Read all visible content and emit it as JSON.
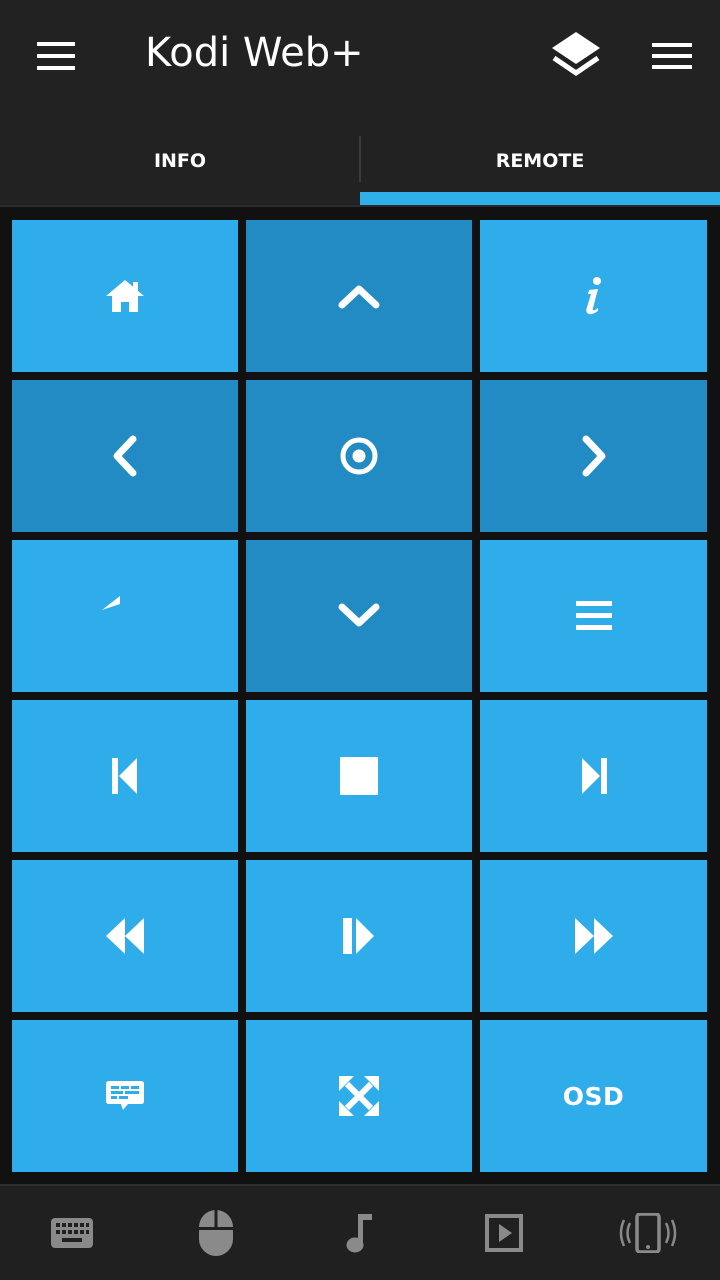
{
  "app": {
    "title": "Kodi Web+"
  },
  "tabs": [
    {
      "label": "INFO"
    },
    {
      "label": "REMOTE"
    }
  ],
  "active_tab": "REMOTE",
  "colors": {
    "appbar": "#222222",
    "accent": "#2fb0e8",
    "tile": "#2fadea",
    "tile_dark": "#228bc3",
    "background": "#111111",
    "bottom_icons": "#8a8a8a"
  },
  "remote": {
    "buttons": [
      {
        "icon": "home-icon"
      },
      {
        "icon": "chevron-up-icon"
      },
      {
        "icon": "info-icon"
      },
      {
        "icon": "chevron-left-icon"
      },
      {
        "icon": "select-circle-icon"
      },
      {
        "icon": "chevron-right-icon"
      },
      {
        "icon": "back-arrow-icon"
      },
      {
        "icon": "chevron-down-icon"
      },
      {
        "icon": "context-menu-icon"
      },
      {
        "icon": "skip-previous-icon"
      },
      {
        "icon": "stop-icon"
      },
      {
        "icon": "skip-next-icon"
      },
      {
        "icon": "rewind-icon"
      },
      {
        "icon": "play-pause-icon"
      },
      {
        "icon": "fast-forward-icon"
      },
      {
        "icon": "subtitles-icon"
      },
      {
        "icon": "fullscreen-icon"
      },
      {
        "label": "OSD"
      }
    ]
  },
  "bottom_nav": [
    {
      "icon": "keyboard-icon"
    },
    {
      "icon": "mouse-icon"
    },
    {
      "icon": "music-note-icon"
    },
    {
      "icon": "video-play-icon"
    },
    {
      "icon": "phone-vibrate-icon"
    }
  ]
}
